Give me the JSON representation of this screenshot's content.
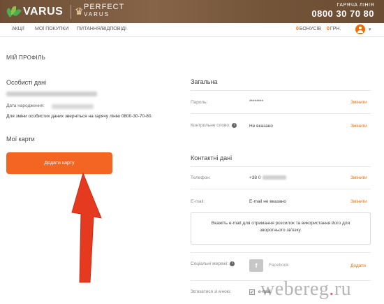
{
  "header": {
    "brand": "VARUS",
    "perfect_line1": "PERFECT",
    "perfect_line2": "VARUS",
    "hotline_label": "ГАРЯЧА ЛІНІЯ",
    "hotline_number": "0800 30 70 80"
  },
  "nav": {
    "items": [
      {
        "label": "АКЦІЇ"
      },
      {
        "label": "МОЇ ПОКУПКИ"
      },
      {
        "label": "ПИТАННЯ/ВІДПОВІДІ"
      }
    ],
    "bonus_value": "0",
    "bonus_label": "БОНУСІВ",
    "grn_value": "0",
    "grn_label": "ГРН."
  },
  "profile": {
    "page_title": "МІЙ ПРОФІЛЬ",
    "personal_title": "Особисті дані",
    "dob_label": "Дата народження:",
    "change_info": "Для зміни особистих даних зверніться на гарячу лінію 0800-30-70-80.",
    "cards_title": "Мої карти",
    "add_card_label": "Додати карту"
  },
  "general": {
    "title": "Загальна",
    "password_label": "Пароль:",
    "password_value": "********",
    "password_action": "Змінити",
    "control_word_label": "Контрольне слово:",
    "control_word_value": "Не вказано",
    "control_word_action": "Змінити"
  },
  "contact": {
    "title": "Контактні дані",
    "phone_label": "Телефон:",
    "phone_value": "+38 0",
    "phone_action": "Змінити",
    "email_label": "E-mail:",
    "email_value": "E-mail не вказано",
    "email_action": "Змінити",
    "email_hint": "Вкажіть e-mail для отримання розсилок та використання його для зворотнього зв'язку.",
    "social_label": "Соціальні мережі:",
    "social_fb_letter": "f",
    "social_fb_name": "Facebook",
    "social_action": "Додати",
    "contact_me_label": "Зв'язатися зі мною:",
    "contact_me_option": "e-mail"
  },
  "watermark": {
    "text_main": "webereg",
    "text_dot": ".",
    "text_tld": "ru"
  },
  "colors": {
    "accent": "#ef6c00",
    "button": "#f26522",
    "header_bg": "#7a5a3e",
    "arrow": "#e53920"
  }
}
